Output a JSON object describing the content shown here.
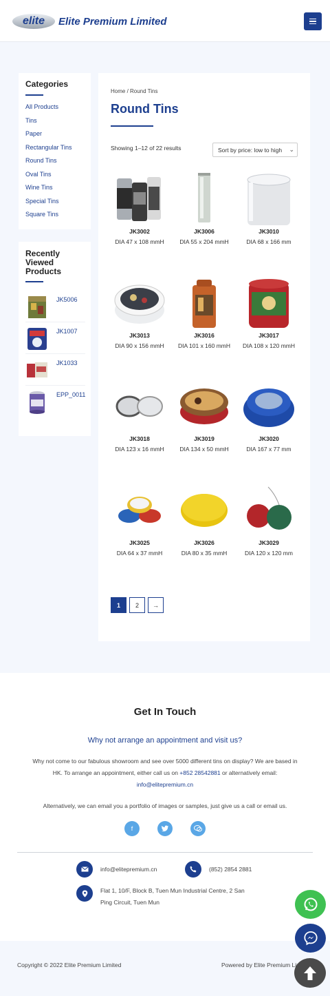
{
  "header": {
    "logo_mark": "elite",
    "logo_text": "Elite Premium Limited",
    "menu_icon": "hamburger-icon"
  },
  "sidebar": {
    "categories_title": "Categories",
    "categories": [
      "All Products",
      "Tins",
      "Paper",
      "Rectangular Tins",
      "Round Tins",
      "Oval Tins",
      "Wine Tins",
      "Special Tins",
      "Square Tins"
    ],
    "recent_title": "Recently Viewed Products",
    "recent": [
      {
        "label": "JK5006"
      },
      {
        "label": "JK1007"
      },
      {
        "label": "JK1033"
      },
      {
        "label": "EPP_0011"
      }
    ]
  },
  "main": {
    "breadcrumb": "Home / Round Tins",
    "title": "Round Tins",
    "showing": "Showing 1–12 of 22 results",
    "sort_selected": "Sort by price: low to high",
    "products": [
      {
        "name": "JK3002",
        "size": "DIA 47 x 108 mmH"
      },
      {
        "name": "JK3006",
        "size": "DIA 55 x 204 mmH"
      },
      {
        "name": "JK3010",
        "size": "DIA 68 x 166 mm"
      },
      {
        "name": "JK3013",
        "size": "DIA 90 x 156 mmH"
      },
      {
        "name": "JK3016",
        "size": "DIA 101 x 160 mmH"
      },
      {
        "name": "JK3017",
        "size": "DIA 108 x 120 mmH"
      },
      {
        "name": "JK3018",
        "size": "DIA 123 x 16 mmH"
      },
      {
        "name": "JK3019",
        "size": "DIA 134 x 50 mmH"
      },
      {
        "name": "JK3020",
        "size": "DIA 167 x 77 mm"
      },
      {
        "name": "JK3025",
        "size": "DIA 64 x 37 mmH"
      },
      {
        "name": "JK3026",
        "size": "DIA 80 x 35 mmH"
      },
      {
        "name": "JK3029",
        "size": "DIA 120 x 120 mm"
      }
    ],
    "pagination": [
      "1",
      "2",
      "→"
    ]
  },
  "footer": {
    "heading": "Get In Touch",
    "subheading": "Why not arrange an appointment and visit us?",
    "para_1": "Why not come to our fabulous showroom and see over 5000 different tins on display? We are based in HK. To arrange an appointment, either call us on",
    "phone_link": "+852 28542881",
    "para_2": "or alternatively email:",
    "email_link": "info@elitepremium.cn",
    "alt_text": "Alternatively, we can email you a portfolio of images or samples, just give us a call or email us.",
    "socials": [
      "facebook-icon",
      "twitter-icon",
      "wechat-icon"
    ],
    "contact_email": "info@elitepremium.cn",
    "contact_phone": "(852) 2854 2881",
    "address": "Flat 1, 10/F, Block B, Tuen Mun Industrial Centre, 2 San Ping Circuit, Tuen Mun",
    "copyright": "Copyright © 2022 Elite Premium Limited",
    "powered": "Powered by Elite Premium Limited"
  },
  "colors": {
    "brand": "#1d3f8f",
    "page_bg": "#f4f7fd",
    "whatsapp": "#3fc152",
    "social": "#5aa7e6"
  }
}
